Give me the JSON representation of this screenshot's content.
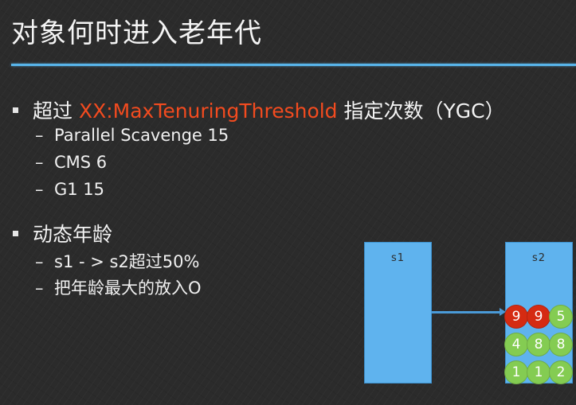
{
  "title": "对象何时进入老年代",
  "bullets": [
    {
      "prefix": "超过 ",
      "highlight": "XX:MaxTenuringThreshold",
      "suffix": " 指定次数（YGC）",
      "subs": [
        "Parallel Scavenge 15",
        "CMS 6",
        "G1 15"
      ]
    },
    {
      "prefix": "动态年龄",
      "subs": [
        "s1 - > s2超过50%",
        "把年龄最大的放入O"
      ]
    }
  ],
  "colors": {
    "highlight": "#f34b1f",
    "accent_rule": "#58b4ea",
    "box": "#5fb3ee",
    "ball_green": "#84cc52",
    "ball_red": "#d52b12"
  },
  "diagram": {
    "s1_label": "s1",
    "s2_label": "s2",
    "balls_rows": [
      [
        {
          "v": "9",
          "color": "red"
        },
        {
          "v": "9",
          "color": "red"
        },
        {
          "v": "5",
          "color": "green"
        }
      ],
      [
        {
          "v": "4",
          "color": "green"
        },
        {
          "v": "8",
          "color": "green"
        },
        {
          "v": "8",
          "color": "green"
        }
      ],
      [
        {
          "v": "1",
          "color": "green"
        },
        {
          "v": "1",
          "color": "green"
        },
        {
          "v": "2",
          "color": "green"
        }
      ]
    ]
  }
}
